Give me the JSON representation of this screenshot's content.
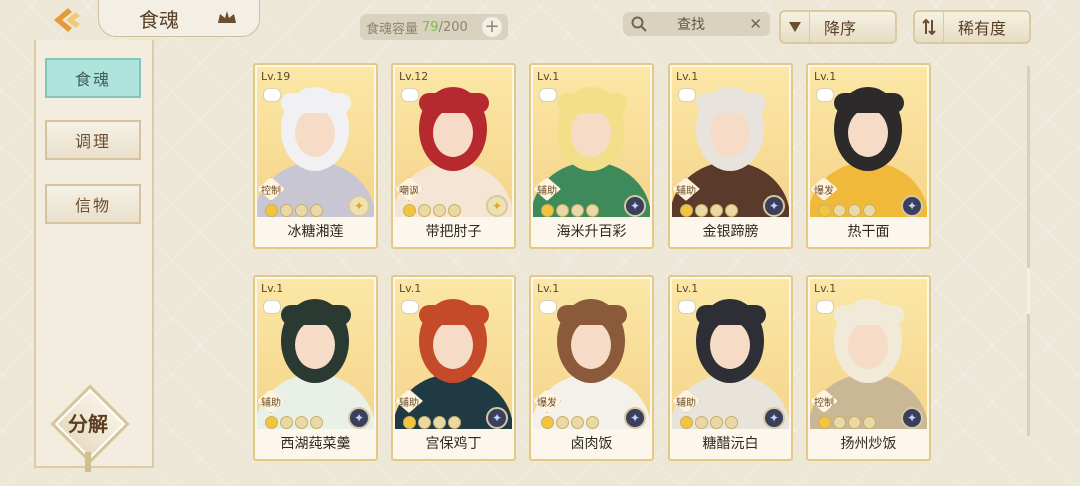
{
  "header": {
    "title": "食魂",
    "capacity_label": "食魂容量",
    "capacity_current": "79",
    "capacity_max": "/200",
    "capacity_add": "+",
    "search_placeholder": "查找",
    "search_clear": "✕",
    "sort_order": "降序",
    "sort_by": "稀有度"
  },
  "sidebar": {
    "tabs": [
      {
        "label": "食魂",
        "active": true
      },
      {
        "label": "调理",
        "active": false
      },
      {
        "label": "信物",
        "active": false
      }
    ],
    "decompose_label": "分解"
  },
  "cards": [
    {
      "level": "Lv.19",
      "role": "控制",
      "name": "冰糖湘莲",
      "stars": 1,
      "rarity": "gold",
      "palette": [
        "#f1f1f4",
        "#c9c6d4"
      ]
    },
    {
      "level": "Lv.12",
      "role": "嘲讽",
      "name": "带把肘子",
      "stars": 1,
      "rarity": "gold",
      "palette": [
        "#b62a2f",
        "#f4e5d4"
      ]
    },
    {
      "level": "Lv.1",
      "role": "辅助",
      "name": "海米升百彩",
      "stars": 1,
      "rarity": "blue",
      "palette": [
        "#f3df8a",
        "#3f8a5a"
      ]
    },
    {
      "level": "Lv.1",
      "role": "辅助",
      "name": "金银蹄膀",
      "stars": 1,
      "rarity": "blue",
      "palette": [
        "#e8e3dd",
        "#5a3a2a"
      ]
    },
    {
      "level": "Lv.1",
      "role": "爆发",
      "name": "热干面",
      "stars": 1,
      "rarity": "blue",
      "palette": [
        "#2c2a2a",
        "#f0b93a"
      ]
    },
    {
      "level": "Lv.1",
      "role": "辅助",
      "name": "西湖莼菜羹",
      "stars": 1,
      "rarity": "blue",
      "palette": [
        "#2a3a32",
        "#e8f0e8"
      ]
    },
    {
      "level": "Lv.1",
      "role": "辅助",
      "name": "宫保鸡丁",
      "stars": 1,
      "rarity": "blue",
      "palette": [
        "#c44a2a",
        "#1f3a45"
      ]
    },
    {
      "level": "Lv.1",
      "role": "爆发",
      "name": "卤肉饭",
      "stars": 1,
      "rarity": "blue",
      "palette": [
        "#8a5a3a",
        "#f4f0ea"
      ]
    },
    {
      "level": "Lv.1",
      "role": "辅助",
      "name": "糖醋沅白",
      "stars": 1,
      "rarity": "blue",
      "palette": [
        "#2e2e36",
        "#e8e4dc"
      ]
    },
    {
      "level": "Lv.1",
      "role": "控制",
      "name": "扬州炒饭",
      "stars": 1,
      "rarity": "blue",
      "palette": [
        "#f1ead8",
        "#c9b796"
      ]
    }
  ]
}
